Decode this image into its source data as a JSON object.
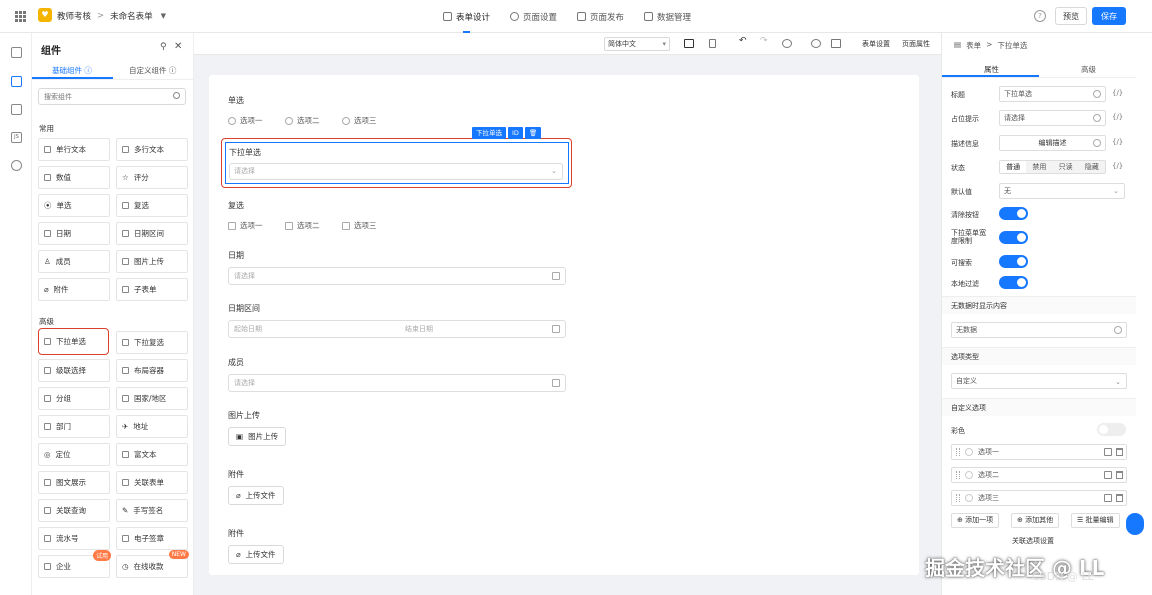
{
  "header": {
    "app_name": "教师考核",
    "form_name": "未命名表单",
    "tabs": [
      "表单设计",
      "页面设置",
      "页面发布",
      "数据管理"
    ],
    "preview_label": "预览",
    "save_label": "保存"
  },
  "components_panel": {
    "title": "组件",
    "tabs": [
      "基础组件",
      "自定义组件"
    ],
    "search_placeholder": "搜索组件",
    "section_common": "常用",
    "section_advanced": "高级",
    "common_items": [
      "单行文本",
      "多行文本",
      "数值",
      "评分",
      "单选",
      "复选",
      "日期",
      "日期区间",
      "成员",
      "图片上传",
      "附件",
      "子表单"
    ],
    "advanced_items": [
      "下拉单选",
      "下拉复选",
      "级联选择",
      "布局容器",
      "分组",
      "国家/地区",
      "部门",
      "地址",
      "定位",
      "富文本",
      "图文展示",
      "关联表单",
      "关联查询",
      "手写签名",
      "流水号",
      "电子签章",
      "企业",
      "在线收款"
    ],
    "badge_trial": "试用",
    "badge_new": "NEW"
  },
  "toolbar": {
    "font": "简体中文",
    "form_settings": "表单设置",
    "page_props": "页面属性"
  },
  "canvas": {
    "radio_label": "单选",
    "options": [
      "选项一",
      "选项二",
      "选项三"
    ],
    "selected_field_label": "下拉单选",
    "selected_field_placeholder": "请选择",
    "selection_tag": "下拉单选",
    "selection_tag_id": "ID",
    "checkbox_label": "复选",
    "date_label": "日期",
    "date_placeholder": "请选择",
    "date_range_label": "日期区间",
    "date_start": "起始日期",
    "date_end": "结束日期",
    "member_label": "成员",
    "member_placeholder": "请选择",
    "image_upload_label": "图片上传",
    "image_upload_btn": "图片上传",
    "attachment_label": "附件",
    "attachment_btn": "上传文件",
    "attachment2_label": "附件",
    "attachment2_btn": "上传文件"
  },
  "props_panel": {
    "breadcrumb": [
      "表单",
      "下拉单选"
    ],
    "tabs": [
      "属性",
      "高级"
    ],
    "title_label": "标题",
    "title_value": "下拉单选",
    "placeholder_label": "占位提示",
    "placeholder_value": "请选择",
    "desc_label": "描述信息",
    "desc_btn": "编辑描述",
    "status_label": "状态",
    "status_options": [
      "普通",
      "禁用",
      "只读",
      "隐藏"
    ],
    "default_label": "默认值",
    "default_value": "无",
    "clear_label": "清除按钮",
    "dropdown_width_label": "下拉菜单宽度限制",
    "searchable_label": "可搜索",
    "local_filter_label": "本地过滤",
    "no_data_section": "无数据时显示内容",
    "no_data_value": "无数据",
    "option_type_section": "选项类型",
    "option_type_value": "自定义",
    "custom_options_section": "自定义选项",
    "color_label": "彩色",
    "options": [
      "选项一",
      "选项二",
      "选项三"
    ],
    "add_one": "添加一项",
    "add_other": "添加其他",
    "batch_edit": "批量编辑",
    "link_setting": "关联选项设置"
  },
  "watermark": {
    "main": "掘金技术社区 @ LL",
    "sub": "CSDN @ LL"
  }
}
